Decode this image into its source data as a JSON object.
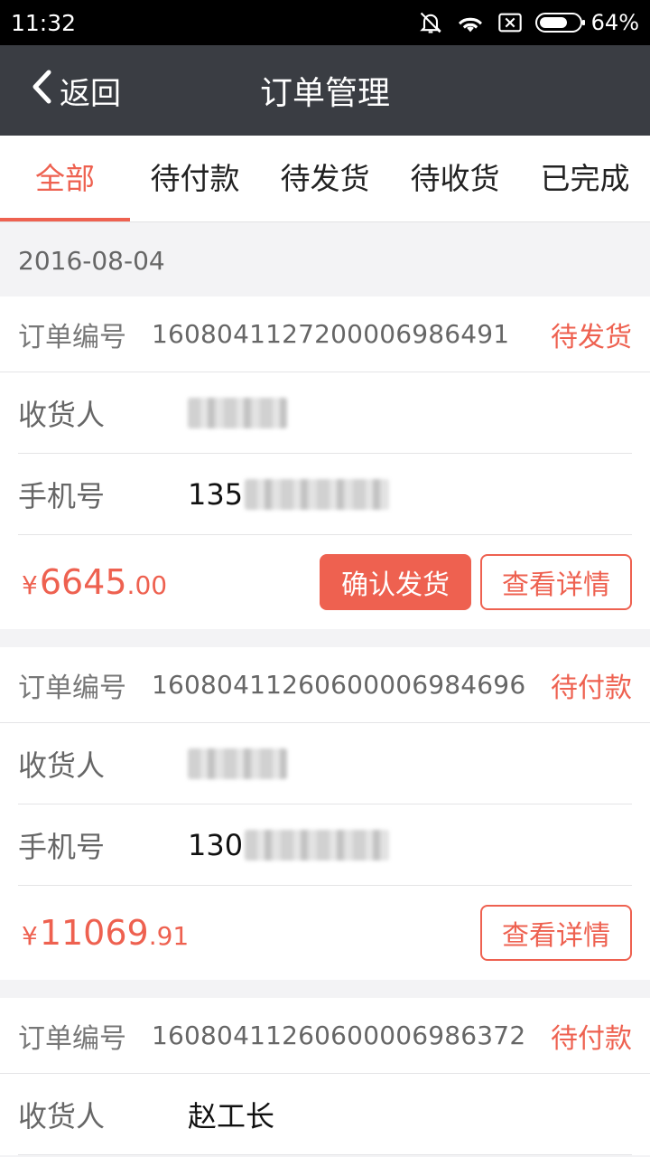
{
  "status_bar": {
    "time": "11:32",
    "battery": "64%",
    "icons": [
      "bell-off-icon",
      "wifi-icon",
      "sim-icon",
      "battery-icon"
    ]
  },
  "app_bar": {
    "back_label": "返回",
    "title": "订单管理"
  },
  "tabs": [
    {
      "label": "全部",
      "active": true
    },
    {
      "label": "待付款",
      "active": false
    },
    {
      "label": "待发货",
      "active": false
    },
    {
      "label": "待收货",
      "active": false
    },
    {
      "label": "已完成",
      "active": false
    }
  ],
  "date": "2016-08-04",
  "labels": {
    "order_no": "订单编号",
    "receiver": "收货人",
    "phone": "手机号"
  },
  "orders": [
    {
      "order_no": "16080411272000069864​91",
      "status": "待发货",
      "receiver": "",
      "phone_prefix": "135",
      "price_yen": "¥",
      "price_int": "6645",
      "price_dec": ".00",
      "confirm_label": "确认发货",
      "detail_label": "查看详情"
    },
    {
      "order_no": "1608041126060000698469​6",
      "status": "待付款",
      "receiver": "",
      "phone_prefix": "130",
      "price_yen": "¥",
      "price_int": "11069",
      "price_dec": ".91",
      "detail_label": "查看详情"
    },
    {
      "order_no": "1608041126060000698637​2",
      "status": "待付款",
      "receiver": "赵工长"
    }
  ],
  "colors": {
    "accent": "#ee6150",
    "app_bar": "#3a3d43",
    "background": "#f3f3f5"
  }
}
